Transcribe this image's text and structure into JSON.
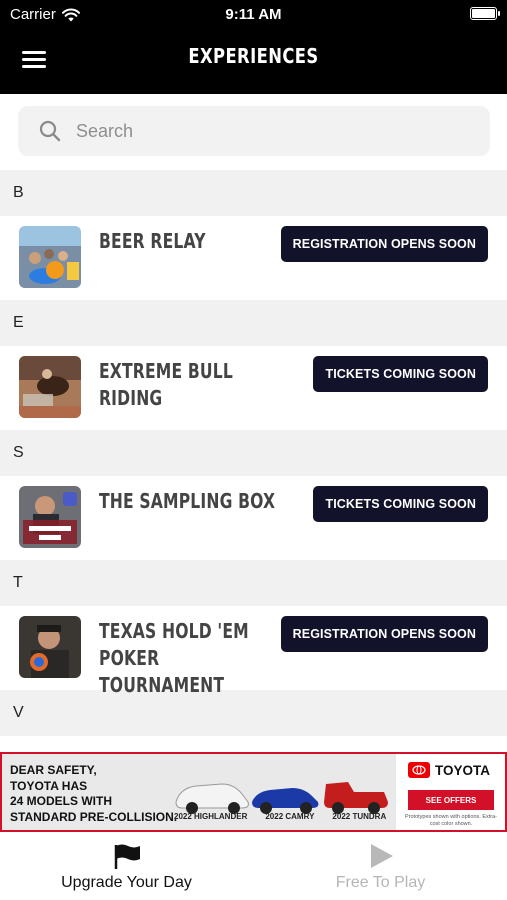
{
  "status": {
    "carrier": "Carrier",
    "time": "9:11 AM"
  },
  "nav": {
    "title": "EXPERIENCES"
  },
  "search": {
    "placeholder": "Search"
  },
  "sections": [
    {
      "letter": "B",
      "items": [
        {
          "title": "BEER RELAY",
          "button": "REGISTRATION OPENS SOON"
        }
      ]
    },
    {
      "letter": "E",
      "items": [
        {
          "title": "EXTREME BULL RIDING",
          "button": "TICKETS COMING SOON"
        }
      ]
    },
    {
      "letter": "S",
      "items": [
        {
          "title": "THE SAMPLING BOX",
          "button": "TICKETS COMING SOON"
        }
      ]
    },
    {
      "letter": "T",
      "items": [
        {
          "title": "TEXAS HOLD 'EM POKER\nTOURNAMENT",
          "button": "REGISTRATION OPENS SOON"
        }
      ]
    },
    {
      "letter": "V",
      "items": []
    }
  ],
  "ad": {
    "headline": "DEAR SAFETY,\nTOYOTA HAS\n24 MODELS WITH\nSTANDARD PRE-COLLISION.",
    "captions": [
      "2022 HIGHLANDER",
      "2022 CAMRY",
      "2022 TUNDRA"
    ],
    "brand": "TOYOTA",
    "cta": "SEE OFFERS",
    "disclaimer": "Prototypes shown with options. Extra-cost color shown."
  },
  "tabs": [
    {
      "label": "Upgrade Your Day",
      "icon": "flag-icon",
      "active": true
    },
    {
      "label": "Free To Play",
      "icon": "play-icon",
      "active": false
    }
  ],
  "colors": {
    "nav_bg": "#000000",
    "button_bg": "#12122a",
    "ad_border": "#d21027",
    "section_bg": "#f1f1f1"
  }
}
